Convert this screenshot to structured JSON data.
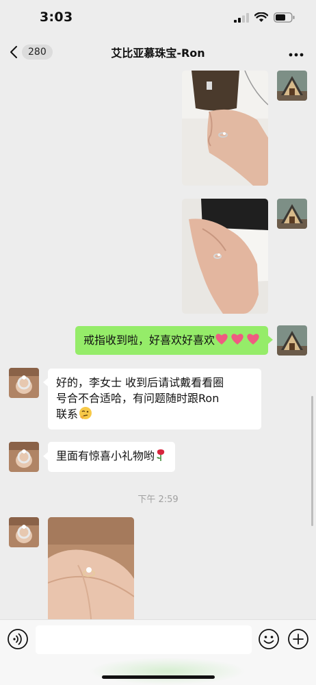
{
  "status_bar": {
    "time": "3:03"
  },
  "nav": {
    "unread_count": "280",
    "title": "艾比亚慕珠宝-Ron"
  },
  "messages": {
    "sent_text": "戒指收到啦，好喜欢好喜欢",
    "reply_line1": "好的，李女士 收到后请试戴看看圈",
    "reply_line2": "号合不合适哈，有问题随时跟Ron",
    "reply_line3": "联系",
    "gift_text": "里面有惊喜小礼物哟"
  },
  "divider": {
    "time": "下午 2:59"
  },
  "icons": {
    "back": "chevron-left-icon",
    "more": "more-dots-icon",
    "voice": "voice-icon",
    "emoji": "smiley-icon",
    "add": "plus-icon"
  },
  "colors": {
    "sent_bubble": "#95ec69",
    "received_bubble": "#ffffff",
    "background": "#ededed"
  }
}
